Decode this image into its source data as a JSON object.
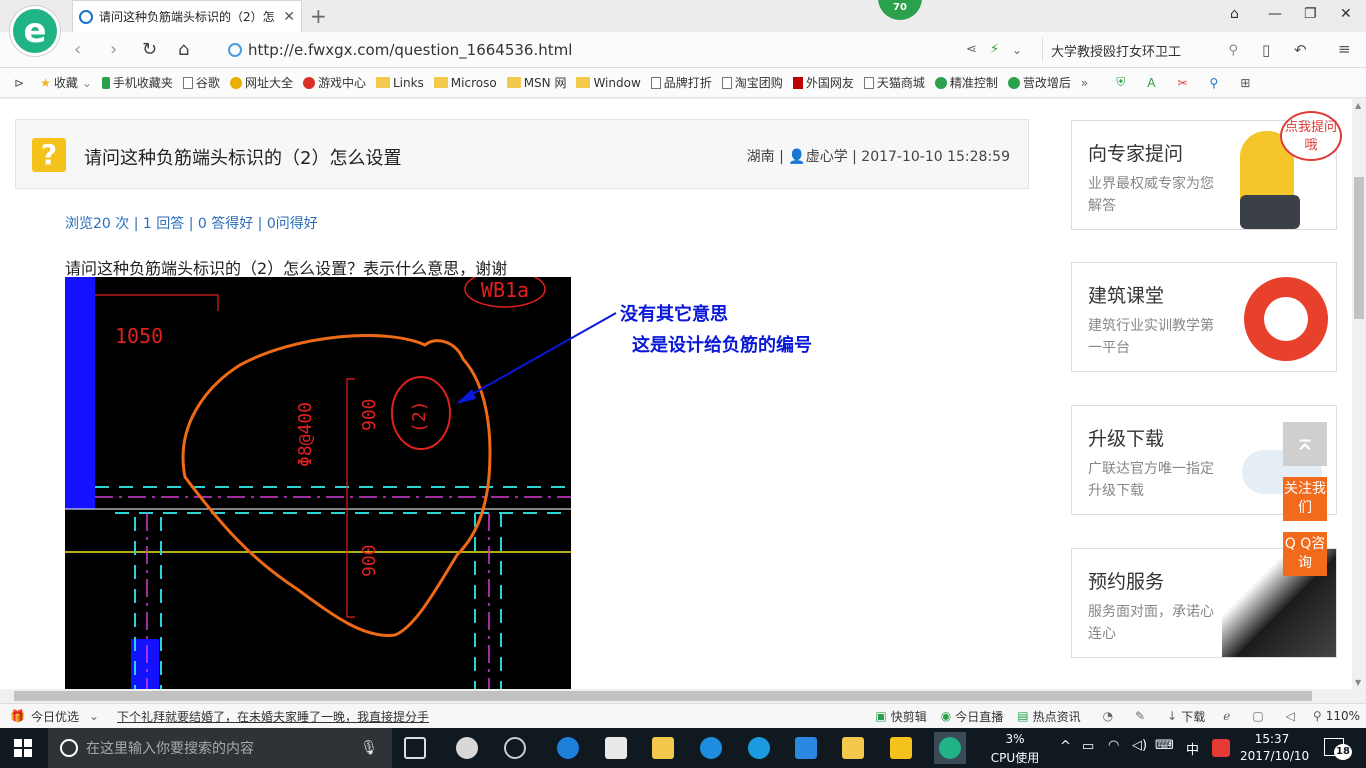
{
  "browser": {
    "tab_title": "请问这种负筋端头标识的（2）怎",
    "badge": "70",
    "url": "http://e.fwxgx.com/question_1664536.html",
    "search_text": "大学教授殴打女环卫工"
  },
  "bookmarks": [
    {
      "label": "收藏",
      "icon": "star-icon"
    },
    {
      "label": "手机收藏夹",
      "icon": "phone-icon"
    },
    {
      "label": "谷歌",
      "icon": "page-icon"
    },
    {
      "label": "网址大全",
      "icon": "globe-icon"
    },
    {
      "label": "游戏中心",
      "icon": "game-icon"
    },
    {
      "label": "Links",
      "icon": "folder-icon"
    },
    {
      "label": "Microso",
      "icon": "folder-icon"
    },
    {
      "label": "MSN 网",
      "icon": "folder-icon"
    },
    {
      "label": "Window",
      "icon": "folder-icon"
    },
    {
      "label": "品牌打折",
      "icon": "page-icon"
    },
    {
      "label": "淘宝团购",
      "icon": "page-icon"
    },
    {
      "label": "外国网友",
      "icon": "page-icon"
    },
    {
      "label": "天猫商城",
      "icon": "page-icon"
    },
    {
      "label": "精准控制",
      "icon": "chat-icon"
    },
    {
      "label": "营改增后",
      "icon": "chat-icon"
    }
  ],
  "question": {
    "title": "请问这种负筋端头标识的（2）怎么设置",
    "meta": "湖南 | 👤虚心学 | 2017-10-10 15:28:59",
    "stats": "浏览20 次 | 1 回答 | 0 答得好 | 0问得好",
    "text": "请问这种负筋端头标识的（2）怎么设置？表示什么意思，谢谢",
    "annotation_line1": "没有其它意思",
    "annotation_line2": "这是设计给负筋的编号",
    "cad_labels": {
      "wb": "WB1a",
      "len": "1050",
      "dim1": "900",
      "rebar": "Φ8@400",
      "mark": "(2)",
      "dim2": "900"
    }
  },
  "sidebar": [
    {
      "title": "向专家提问",
      "sub": "业界最权威专家为您解答",
      "bubble": "点我提问哦"
    },
    {
      "title": "建筑课堂",
      "sub": "建筑行业实训教学第一平台"
    },
    {
      "title": "升级下载",
      "sub": "广联达官方唯一指定升级下载"
    },
    {
      "title": "预约服务",
      "sub": "服务面对面，承诺心连心"
    }
  ],
  "floating": {
    "follow": "关注我们",
    "qq": "Q Q咨询"
  },
  "statusbar": {
    "today": "今日优选",
    "news": "下个礼拜就要结婚了，在未婚夫家睡了一晚，我直接提分手",
    "items": [
      "快剪辑",
      "今日直播",
      "热点资讯"
    ],
    "download": "下载",
    "zoom": "110%"
  },
  "taskbar": {
    "search_placeholder": "在这里输入你要搜索的内容",
    "cpu_value": "3%",
    "cpu_label": "CPU使用",
    "ime": "中",
    "time": "15:37",
    "date": "2017/10/10",
    "notif": "18"
  },
  "colors": {
    "accent_green": "#1fb386",
    "link_blue": "#2a6ebb",
    "annotation_blue": "#0a18d8",
    "float_orange": "#f26a1b"
  }
}
